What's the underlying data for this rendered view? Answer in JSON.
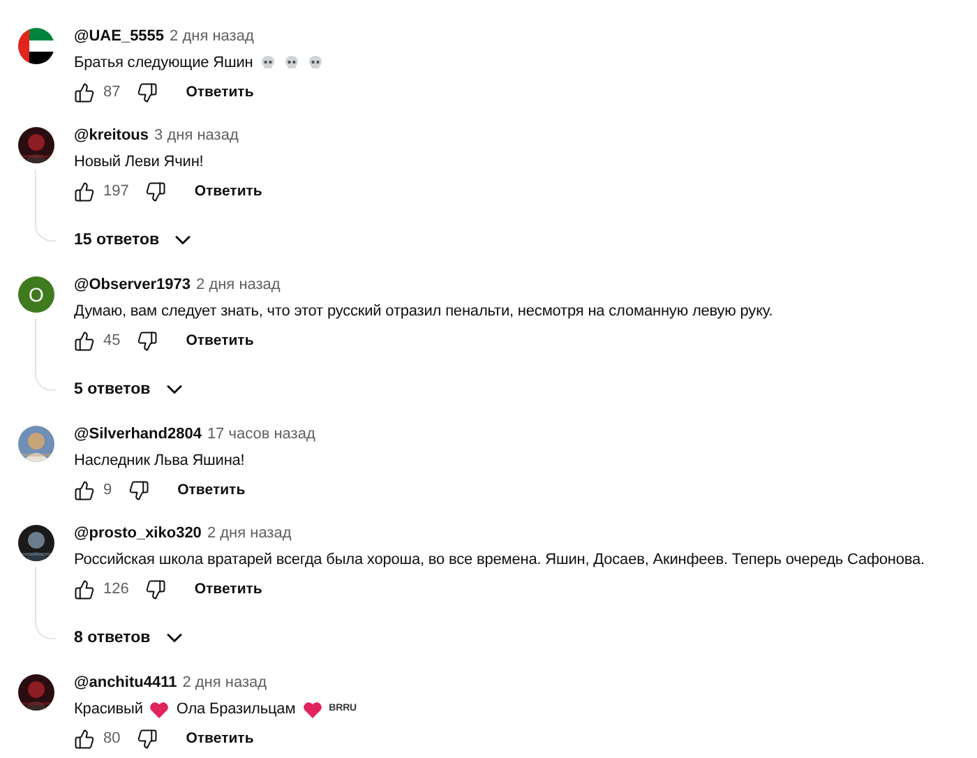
{
  "comments": [
    {
      "avatar": {
        "kind": "flag"
      },
      "author": "@UAE_5555",
      "time": "2 дня назад",
      "body": [
        {
          "kind": "text",
          "text": "Братья следующие Яшин"
        },
        {
          "kind": "skull"
        },
        {
          "kind": "skull"
        },
        {
          "kind": "skull"
        }
      ],
      "likes": "87",
      "reply_label": "Ответить"
    },
    {
      "avatar": {
        "kind": "picture"
      },
      "author": "@kreitous",
      "time": "3 дня назад",
      "body": [
        {
          "kind": "text",
          "text": "Новый Леви Ячин!"
        }
      ],
      "likes": "197",
      "reply_label": "Ответить",
      "replies": "15 ответов"
    },
    {
      "avatar": {
        "kind": "letter",
        "letter": "O",
        "color": "#3f7a1e"
      },
      "author": "@Observer1973",
      "time": "2 дня назад",
      "body": [
        {
          "kind": "text",
          "text": "Думаю, вам следует знать, что этот русский отразил пенальти, несмотря на сломанную левую руку."
        }
      ],
      "likes": "45",
      "reply_label": "Ответить",
      "replies": "5 ответов"
    },
    {
      "avatar": {
        "kind": "picture"
      },
      "author": "@Silverhand2804",
      "time": "17 часов назад",
      "body": [
        {
          "kind": "text",
          "text": "Наследник Льва Яшина!"
        }
      ],
      "likes": "9",
      "reply_label": "Ответить"
    },
    {
      "avatar": {
        "kind": "picture"
      },
      "author": "@prosto_xiko320",
      "time": "2 дня назад",
      "body": [
        {
          "kind": "text",
          "text": "Российская школа вратарей всегда была хороша, во все времена. Яшин, Досаев, Акинфеев. Теперь очередь Сафонова."
        }
      ],
      "likes": "126",
      "reply_label": "Ответить",
      "replies": "8 ответов"
    },
    {
      "avatar": {
        "kind": "picture"
      },
      "author": "@anchitu4411",
      "time": "2 дня назад",
      "body": [
        {
          "kind": "text",
          "text": "Красивый"
        },
        {
          "kind": "heart"
        },
        {
          "kind": "text",
          "text": "Ола Бразильцам"
        },
        {
          "kind": "heart"
        },
        {
          "kind": "tag",
          "text": "BRRU"
        }
      ],
      "likes": "80",
      "reply_label": "Ответить"
    }
  ]
}
